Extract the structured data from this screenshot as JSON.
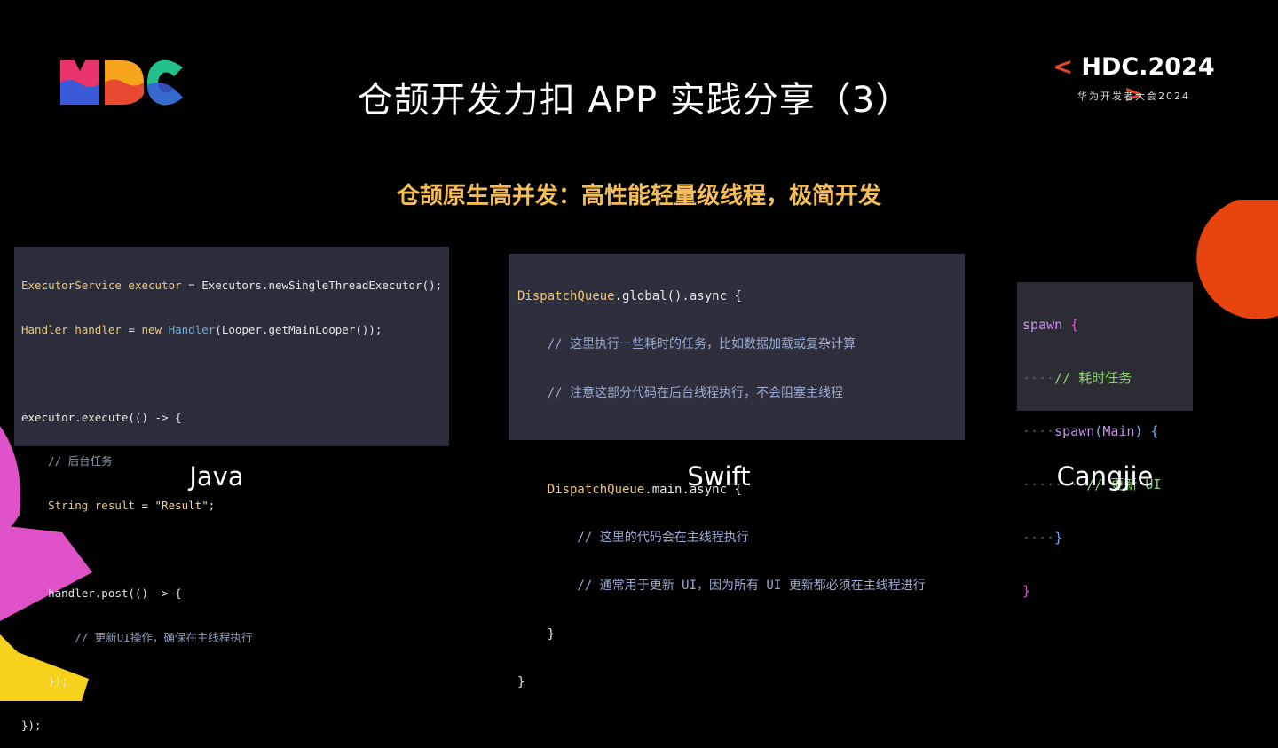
{
  "slide": {
    "title": "仓颉开发力扣 APP 实践分享（3）",
    "subtitle": "仓颉原生高并发：高性能轻量级线程，极简开发"
  },
  "branding": {
    "left_logo": "HDC",
    "right_logo": "HDC.2024",
    "right_subtitle": "华为开发者大会2024",
    "accent_color": "#e8462b"
  },
  "examples": [
    {
      "language": "Java",
      "code": [
        "ExecutorService executor = Executors.newSingleThreadExecutor();",
        "Handler handler = new Handler(Looper.getMainLooper());",
        "",
        "executor.execute(() -> {",
        "    // 后台任务",
        "    String result = \"Result\";",
        "",
        "    handler.post(() -> {",
        "        // 更新UI操作，确保在主线程执行",
        "    });",
        "});"
      ]
    },
    {
      "language": "Swift",
      "code": [
        "DispatchQueue.global().async {",
        "    // 这里执行一些耗时的任务，比如数据加载或复杂计算",
        "    // 注意这部分代码在后台线程执行，不会阻塞主线程",
        "",
        "    DispatchQueue.main.async {",
        "        // 这里的代码会在主线程执行",
        "        // 通常用于更新 UI，因为所有 UI 更新都必须在主线程进行",
        "    }",
        "}"
      ]
    },
    {
      "language": "Cangjie",
      "code": [
        "spawn {",
        "    // 耗时任务",
        "    spawn(Main) {",
        "        // 更新 UI",
        "    }",
        "}"
      ]
    }
  ]
}
